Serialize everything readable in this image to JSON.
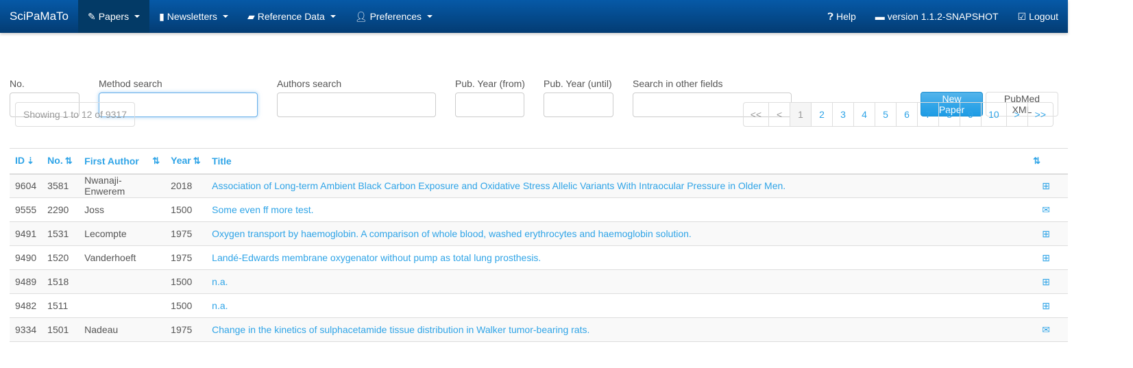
{
  "navbar": {
    "brand": "SciPaMaTo",
    "items": [
      {
        "label": "Papers",
        "icon": "paperclip-icon",
        "active": true
      },
      {
        "label": "Newsletters",
        "icon": "book-icon"
      },
      {
        "label": "Reference Data",
        "icon": "folder-open-icon"
      },
      {
        "label": "Preferences",
        "icon": "user-icon"
      }
    ],
    "right": [
      {
        "label": "Help",
        "icon": "question-circle-icon"
      },
      {
        "label": "version 1.1.2-SNAPSHOT",
        "icon": "briefcase-icon"
      },
      {
        "label": "Logout",
        "icon": "edit-icon"
      }
    ]
  },
  "filters": {
    "number": {
      "label": "No.",
      "value": ""
    },
    "method": {
      "label": "Method search",
      "value": ""
    },
    "authors": {
      "label": "Authors search",
      "value": ""
    },
    "year_from": {
      "label": "Pub. Year (from)",
      "value": ""
    },
    "year_until": {
      "label": "Pub. Year (until)",
      "value": ""
    },
    "other": {
      "label": "Search in other fields",
      "value": ""
    }
  },
  "buttons": {
    "new_paper": "New Paper",
    "pubmed_xml": "PubMed XML"
  },
  "showing": "Showing 1 to 12 of 9317",
  "pagination": {
    "first": "<<",
    "prev": "<",
    "pages": [
      "1",
      "2",
      "3",
      "4",
      "5",
      "6",
      "7",
      "8",
      "9",
      "10"
    ],
    "current": "1",
    "next": ">",
    "last": ">>"
  },
  "table": {
    "headers": {
      "id": "ID",
      "no": "No.",
      "author": "First Author",
      "year": "Year",
      "title": "Title"
    },
    "rows": [
      {
        "id": "9604",
        "no": "3581",
        "author": "Nwanaji-Enwerem",
        "year": "2018",
        "title": "Association of Long-term Ambient Black Carbon Exposure and Oxidative Stress Allelic Variants With Intraocular Pressure in Older Men.",
        "icon": "plus-square-icon"
      },
      {
        "id": "9555",
        "no": "2290",
        "author": "Joss",
        "year": "1500",
        "title": "Some even ff more test.",
        "icon": "envelope-open-icon"
      },
      {
        "id": "9491",
        "no": "1531",
        "author": "Lecompte",
        "year": "1975",
        "title": "Oxygen transport by haemoglobin. A comparison of whole blood, washed erythrocytes and haemoglobin solution.",
        "icon": "plus-square-icon"
      },
      {
        "id": "9490",
        "no": "1520",
        "author": "Vanderhoeft",
        "year": "1975",
        "title": "Landé-Edwards membrane oxygenator without pump as total lung prosthesis.",
        "icon": "plus-square-icon"
      },
      {
        "id": "9489",
        "no": "1518",
        "author": "",
        "year": "1500",
        "title": "n.a.",
        "icon": "plus-square-icon"
      },
      {
        "id": "9482",
        "no": "1511",
        "author": "",
        "year": "1500",
        "title": "n.a.",
        "icon": "plus-square-icon"
      },
      {
        "id": "9334",
        "no": "1501",
        "author": "Nadeau",
        "year": "1975",
        "title": "Change in the kinetics of sulphacetamide tissue distribution in Walker tumor-bearing rats.",
        "icon": "envelope-icon"
      }
    ]
  },
  "colors": {
    "navbar": "#044c8f",
    "accent": "#2fa4e7"
  }
}
